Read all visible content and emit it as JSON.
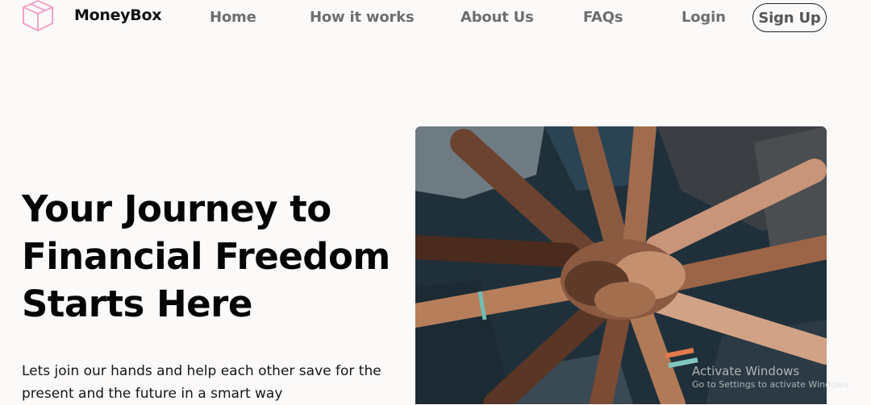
{
  "brand": {
    "name": "MoneyBox",
    "logo_icon": "box-icon",
    "accent_color": "#f2a2c7"
  },
  "nav": {
    "links": [
      {
        "label": "Home"
      },
      {
        "label": "How it works"
      },
      {
        "label": "About Us"
      },
      {
        "label": "FAQs"
      },
      {
        "label": "Login"
      }
    ],
    "signup_label": "Sign Up"
  },
  "hero": {
    "title_lines": [
      "Your Journey to",
      "Financial Freedom",
      "Starts Here"
    ],
    "subtitle_lines": [
      "Lets join our hands and help each other save for the",
      "present and the future in a smart way"
    ],
    "image": "hands-together-photo"
  },
  "watermark": {
    "line1": "Activate Windows",
    "line2": "Go to Settings to activate Windows."
  }
}
